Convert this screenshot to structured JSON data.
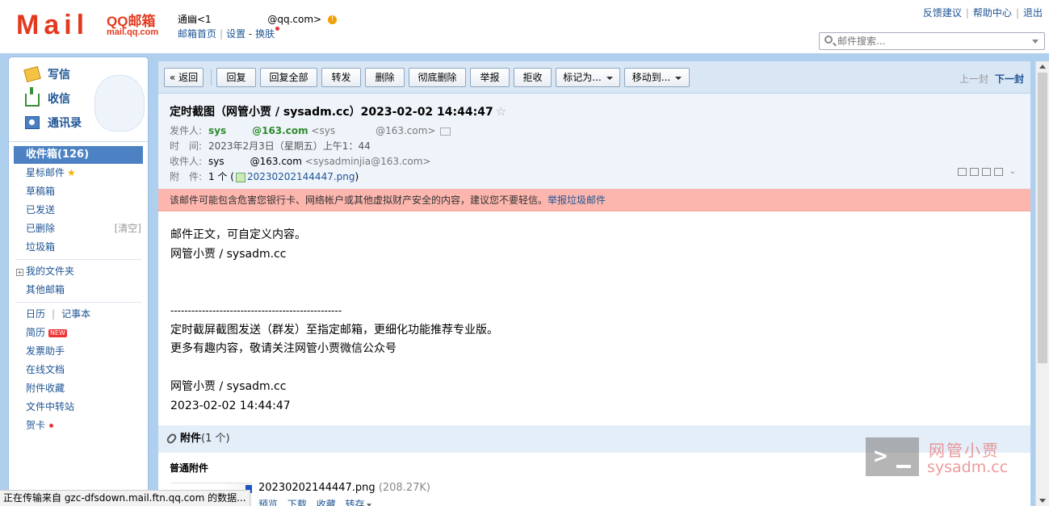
{
  "brand": {
    "logo_text": "Mail",
    "logo_cn": "QQ邮箱",
    "logo_domain": "mail.qq.com"
  },
  "account": {
    "name": "通幽<1",
    "email": "@qq.com>"
  },
  "header_links": {
    "home": "邮箱首页",
    "settings": "设置",
    "separator": "-",
    "skin": "换肤"
  },
  "top_links": {
    "feedback": "反馈建议",
    "help": "帮助中心",
    "logout": "退出"
  },
  "search": {
    "placeholder": "邮件搜索..."
  },
  "quick": {
    "compose": "写信",
    "inbox": "收信",
    "contacts": "通讯录"
  },
  "folders": {
    "inbox": "收件箱(126)",
    "starred": "星标邮件",
    "drafts": "草稿箱",
    "sent": "已发送",
    "deleted": "已删除",
    "clear": "[清空]",
    "spam": "垃圾箱",
    "my_folders": "我的文件夹",
    "other_mail": "其他邮箱",
    "calendar": "日历",
    "sep": "|",
    "notes": "记事本",
    "resume": "简历",
    "new_badge": "NEW",
    "invoice": "发票助手",
    "docs": "在线文档",
    "att_collect": "附件收藏",
    "file_transfer": "文件中转站",
    "cards": "贺卡"
  },
  "toolbar": {
    "back": "« 返回",
    "reply": "回复",
    "reply_all": "回复全部",
    "forward": "转发",
    "delete": "删除",
    "delete_perm": "彻底删除",
    "report": "举报",
    "reject": "拒收",
    "mark_as": "标记为...",
    "move_to": "移动到...",
    "prev": "上一封",
    "next": "下一封"
  },
  "mail": {
    "subject": "定时截图（网管小贾 / sysadm.cc）2023-02-02 14:44:47",
    "from_label": "发件人:",
    "from_name_a": "sys",
    "from_name_b": "@163.com",
    "from_addr_a": "<sys",
    "from_addr_b": "@163.com>",
    "time_label": "时　间:",
    "time": "2023年2月3日（星期五）上午1：44",
    "to_label": "收件人:",
    "to_name_a": "sys",
    "to_name_b": "@163.com",
    "to_addr": "<sysadminjia@163.com>",
    "att_label": "附　件:",
    "att_count": "1 个 (",
    "att_file": "20230202144447.png",
    "att_close": ")",
    "warning": "该邮件可能包含危害您银行卡、网络帐户或其他虚拟财产安全的内容，建议您不要轻信。",
    "warning_link": "举报垃圾邮件",
    "body": [
      "邮件正文，可自定义内容。",
      "网管小贾 / sysadm.cc",
      "",
      "",
      "-------------------------------------------------",
      "定时截屏截图发送（群发）至指定邮箱，更细化功能推荐专业版。",
      "更多有趣内容，敬请关注网管小贾微信公众号",
      "",
      "网管小贾 / sysadm.cc",
      "2023-02-02 14:44:47"
    ]
  },
  "attachments": {
    "title": "附件",
    "count": "(1 个)",
    "group": "普通附件",
    "file": "20230202144447.png",
    "size": "(208.27K)",
    "actions": {
      "preview": "预览",
      "download": "下载",
      "collect": "收藏",
      "save": "转存"
    }
  },
  "status_text": "正在传输来自 gzc-dfsdown.mail.ftn.qq.com 的数据...",
  "watermark": {
    "cn": "网管小贾",
    "en": "sysadm.cc"
  }
}
